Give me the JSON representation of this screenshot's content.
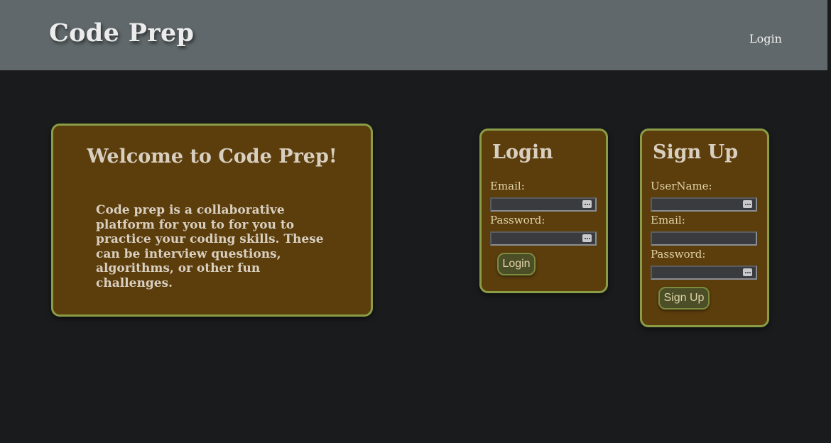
{
  "header": {
    "brand": "Code Prep",
    "login_link": "Login"
  },
  "welcome": {
    "title": "Welcome to Code Prep!",
    "text": "Code prep is a collaborative platform for you to for you to practice your coding skills. These can be interview questions, algorithms, or other fun challenges."
  },
  "login_form": {
    "title": "Login",
    "email_label": "Email:",
    "email_value": "",
    "password_label": "Password:",
    "password_value": "",
    "submit_label": "Login"
  },
  "signup_form": {
    "title": "Sign Up",
    "username_label": "UserName:",
    "username_value": "",
    "email_label": "Email:",
    "email_value": "",
    "password_label": "Password:",
    "password_value": "",
    "submit_label": "Sign Up"
  },
  "colors": {
    "background": "#1a1b1d",
    "navbar": "#60686b",
    "card": "#5c3e0d",
    "card_border": "#8a9c45",
    "button": "#4b4e27"
  }
}
